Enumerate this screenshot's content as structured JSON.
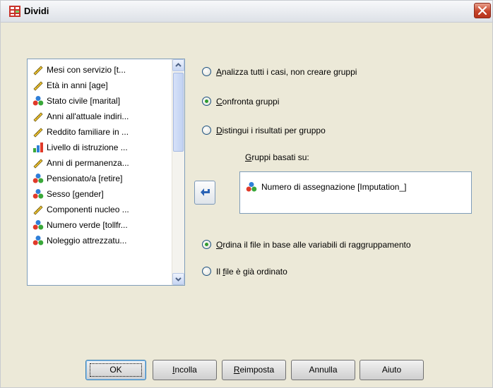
{
  "window": {
    "title": "Dividi"
  },
  "variables": [
    {
      "label": "Mesi con servizio [t...",
      "icon": "scale-icon"
    },
    {
      "label": "Età in anni [age]",
      "icon": "scale-icon"
    },
    {
      "label": "Stato civile [marital]",
      "icon": "nominal-icon"
    },
    {
      "label": "Anni all'attuale indiri...",
      "icon": "scale-icon"
    },
    {
      "label": "Reddito familiare in ...",
      "icon": "scale-icon"
    },
    {
      "label": "Livello di istruzione ...",
      "icon": "ordinal-icon"
    },
    {
      "label": "Anni di permanenza...",
      "icon": "scale-icon"
    },
    {
      "label": "Pensionato/a [retire]",
      "icon": "nominal-icon"
    },
    {
      "label": "Sesso [gender]",
      "icon": "nominal-icon"
    },
    {
      "label": "Componenti nucleo ...",
      "icon": "scale-icon"
    },
    {
      "label": "Numero verde [tollfr...",
      "icon": "nominal-icon"
    },
    {
      "label": "Noleggio attrezzatu...",
      "icon": "nominal-icon"
    }
  ],
  "mode_options": [
    {
      "accel": "A",
      "rest": "nalizza tutti i casi, non creare gruppi",
      "selected": false
    },
    {
      "accel": "C",
      "rest": "onfronta gruppi",
      "selected": true
    },
    {
      "accel": "D",
      "rest": "istingui i risultati per gruppo",
      "selected": false
    }
  ],
  "groups": {
    "label_accel": "G",
    "label_rest": "ruppi basati su:",
    "items": [
      {
        "label": "Numero di assegnazione [Imputation_]",
        "icon": "nominal-icon"
      }
    ]
  },
  "sort_options": [
    {
      "pre": "",
      "accel": "O",
      "rest": "rdina il file in base alle variabili di raggruppamento",
      "selected": true
    },
    {
      "pre": "Il ",
      "accel": "f",
      "rest": "ile è già ordinato",
      "selected": false
    }
  ],
  "buttons": [
    {
      "pre": "",
      "accel": "",
      "rest": "OK"
    },
    {
      "pre": "",
      "accel": "I",
      "rest": "ncolla"
    },
    {
      "pre": "",
      "accel": "R",
      "rest": "eimposta"
    },
    {
      "pre": "",
      "accel": "",
      "rest": "Annulla"
    },
    {
      "pre": "",
      "accel": "",
      "rest": "Aiuto"
    }
  ],
  "colors": {
    "selected_radio": "#2f9a2f",
    "close_button": "#c6442a",
    "list_border": "#7f9db9"
  }
}
